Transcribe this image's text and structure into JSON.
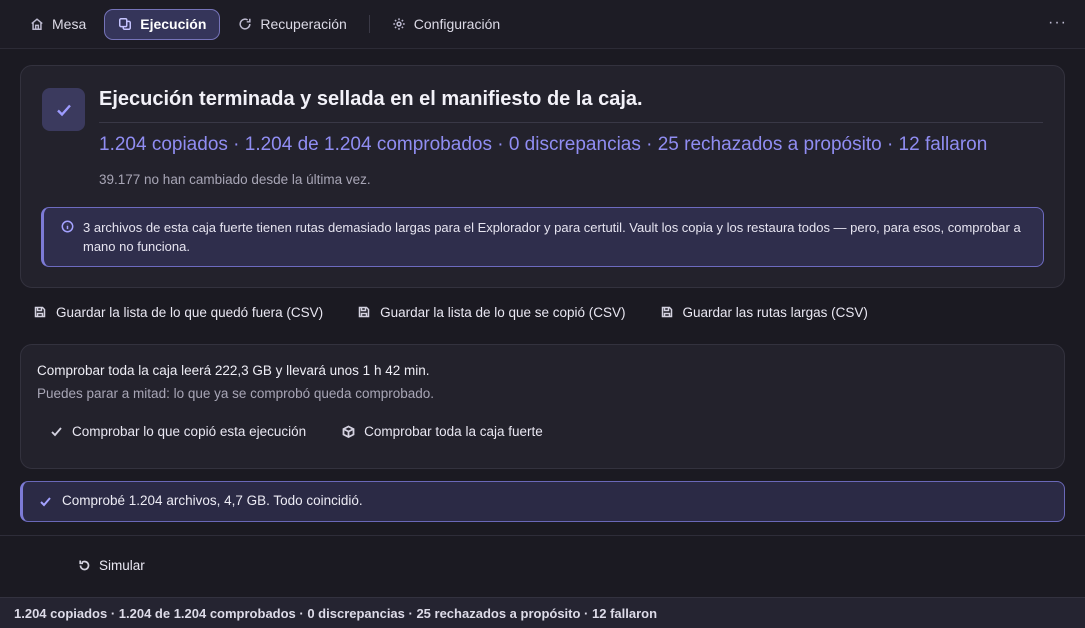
{
  "nav": {
    "tabs": [
      {
        "label": "Mesa",
        "icon": "home-icon"
      },
      {
        "label": "Ejecución",
        "icon": "copy-icon",
        "active": true
      },
      {
        "label": "Recuperación",
        "icon": "refresh-icon"
      },
      {
        "label": "Configuración",
        "icon": "gear-icon"
      }
    ],
    "more_label": "···"
  },
  "status": {
    "title": "Ejecución terminada y sellada en el manifiesto de la caja.",
    "summary": "1.204 copiados · 1.204 de 1.204 comprobados · 0 discrepancias · 25 rechazados a propósito · 12 fallaron",
    "unchanged": "39.177 no han cambiado desde la última vez.",
    "notice": "3 archivos de esta caja fuerte tienen rutas demasiado largas para el Explorador y para certutil. Vault los copia y los restaura todos — pero, para esos, comprobar a mano no funciona."
  },
  "save_actions": [
    "Guardar la lista de lo que quedó fuera (CSV)",
    "Guardar la lista de lo que se copió (CSV)",
    "Guardar las rutas largas (CSV)"
  ],
  "verify": {
    "line1": "Comprobar toda la caja leerá 222,3 GB y llevará unos 1 h 42 min.",
    "line2": "Puedes parar a mitad: lo que ya se comprobó queda comprobado.",
    "btn_run": "Comprobar lo que copió esta ejecución",
    "btn_vault": "Comprobar toda la caja fuerte"
  },
  "result": "Comprobé 1.204 archivos, 4,7 GB. Todo coincidió.",
  "simulate_label": "Simular",
  "statusbar": "1.204 copiados · 1.204 de 1.204 comprobados · 0 discrepancias · 25 rechazados a propósito · 12 fallaron",
  "colors": {
    "accent": "#908df2",
    "background": "#1b1a22",
    "panel": "#23222c"
  }
}
